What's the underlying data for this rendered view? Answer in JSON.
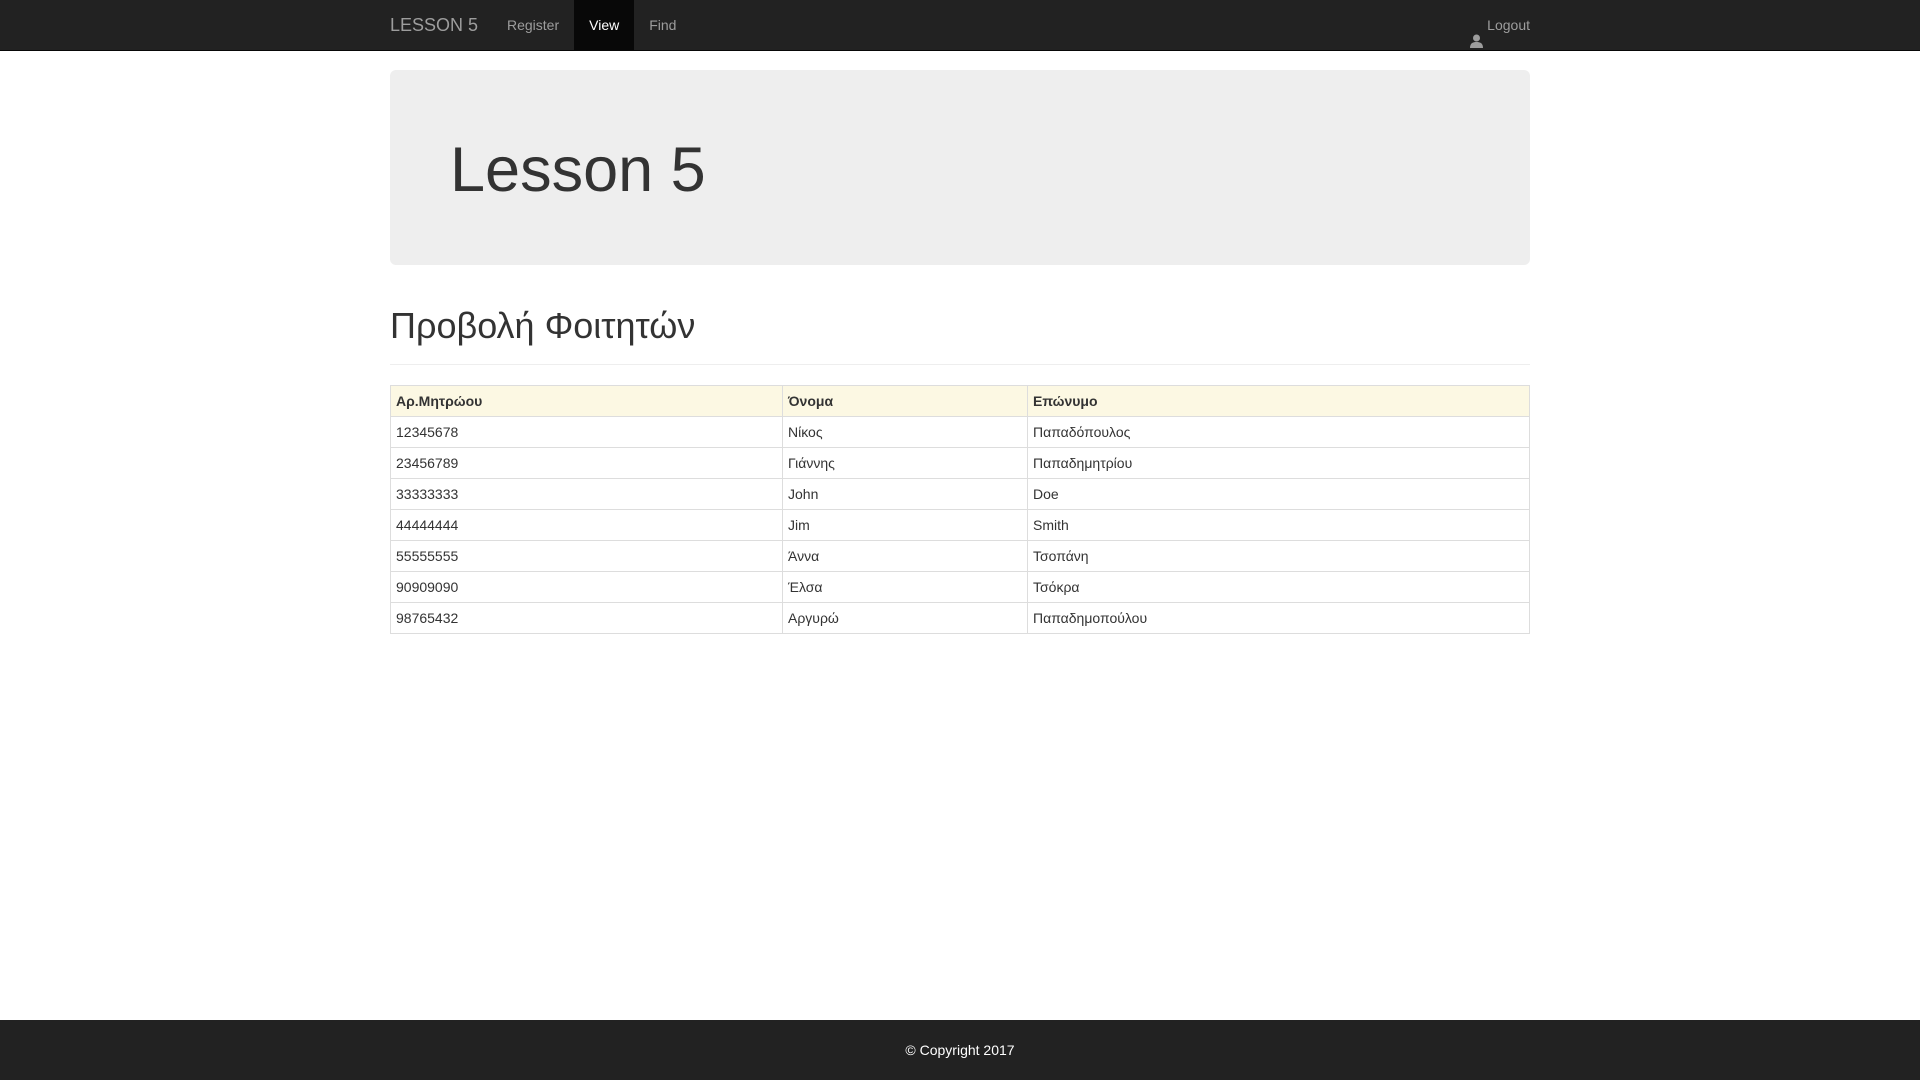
{
  "navbar": {
    "brand": "LESSON 5",
    "links": [
      {
        "label": "Register",
        "active": false
      },
      {
        "label": "View",
        "active": true
      },
      {
        "label": "Find",
        "active": false
      }
    ],
    "logout_label": "Logout",
    "logout_icon": "user-icon"
  },
  "jumbotron": {
    "title": "Lesson 5"
  },
  "page_header": {
    "title": "Προβολή Φοιτητών"
  },
  "table": {
    "headers": [
      "Αρ.Μητρώου",
      "Όνομα",
      "Επώνυμο"
    ],
    "rows": [
      [
        "12345678",
        "Νίκος",
        "Παπαδόπουλος"
      ],
      [
        "23456789",
        "Γιάννης",
        "Παπαδημητρίου"
      ],
      [
        "33333333",
        "John",
        "Doe"
      ],
      [
        "44444444",
        "Jim",
        "Smith"
      ],
      [
        "55555555",
        "Άννα",
        "Τσοπάνη"
      ],
      [
        "90909090",
        "Έλσα",
        "Τσόκρα"
      ],
      [
        "98765432",
        "Αργυρώ",
        "Παπαδημοπούλου"
      ]
    ]
  },
  "footer": {
    "text": "© Copyright 2017"
  },
  "colors": {
    "navbar_bg": "#222222",
    "navbar_active_bg": "#080808",
    "jumbotron_bg": "#eeeeee",
    "table_header_bg": "#fcf8e3",
    "footer_bg": "#222222"
  }
}
